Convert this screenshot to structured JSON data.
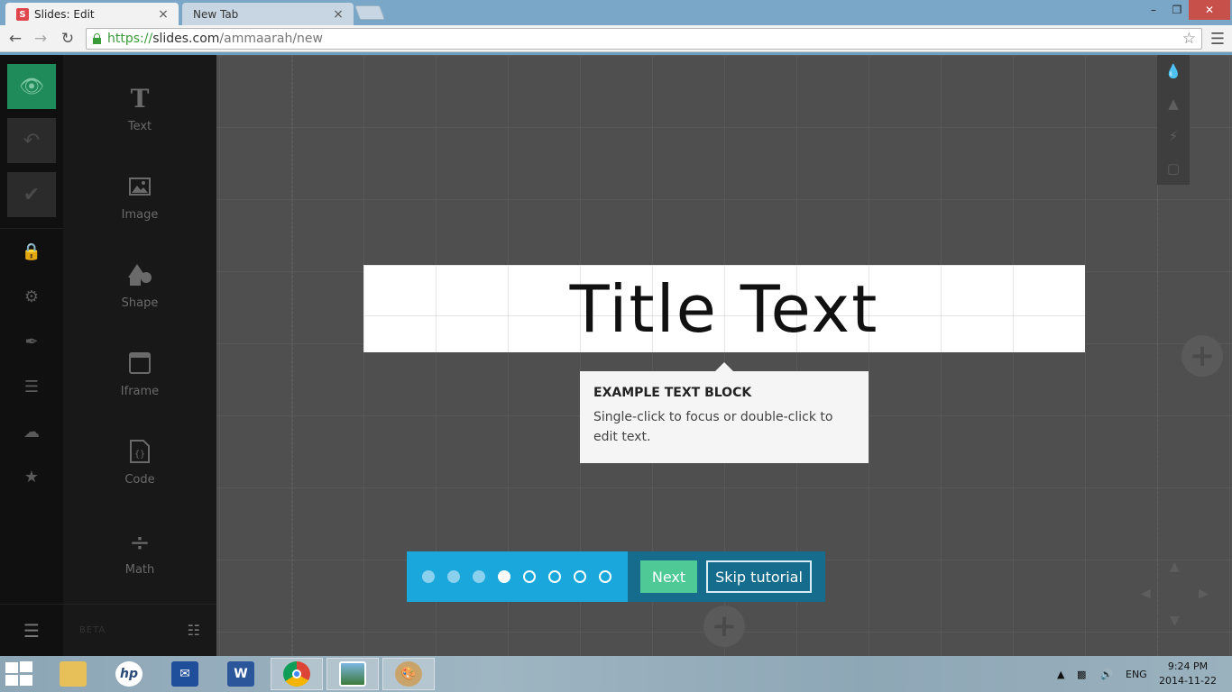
{
  "browser": {
    "tabs": [
      {
        "label": "Slides: Edit",
        "favicon": "S",
        "close": "×",
        "active": true
      },
      {
        "label": "New Tab",
        "close": "×",
        "active": false
      }
    ],
    "window_controls": {
      "minimize": "–",
      "maximize": "❐",
      "close": "✕"
    },
    "url": {
      "scheme": "https://",
      "host": "slides.com",
      "path": "/ammaarah/new"
    },
    "bookmark_icon": "star-icon",
    "menu_icon": "hamburger-menu-icon"
  },
  "editor": {
    "left_toolbar": {
      "buttons": [
        "eye-icon",
        "undo-icon",
        "checkmark-icon"
      ],
      "icons": [
        "lock-icon",
        "gear-icon",
        "brush-icon",
        "layers-icon",
        "cloud-lock-icon",
        "star-icon"
      ],
      "menu_icon": "hamburger-menu-icon"
    },
    "blocks": [
      {
        "label": "Text",
        "icon": "T"
      },
      {
        "label": "Image",
        "icon": "image-icon"
      },
      {
        "label": "Shape",
        "icon": "shape-icon"
      },
      {
        "label": "Iframe",
        "icon": "iframe-icon"
      },
      {
        "label": "Code",
        "icon": "code-icon"
      },
      {
        "label": "Math",
        "icon": "divide-icon"
      }
    ],
    "beta_label": "BETA",
    "slide": {
      "title": "Title Text"
    },
    "tooltip": {
      "title": "EXAMPLE TEXT BLOCK",
      "body": "Single-click to focus or double-click to edit text."
    },
    "right_toolbar": [
      "droplet-icon",
      "chart-icon",
      "lightning-icon",
      "book-icon"
    ],
    "tutorial": {
      "steps": [
        "visited",
        "visited",
        "visited",
        "current",
        "todo",
        "todo",
        "todo",
        "todo"
      ],
      "next_label": "Next",
      "skip_label": "Skip tutorial"
    },
    "colors": {
      "accent_green": "#1f8a5a",
      "tutorial_blue": "#1aa7dc",
      "tutorial_dark": "#166c8c",
      "next_green": "#4fc995"
    }
  },
  "taskbar": {
    "apps": [
      "file-explorer-icon",
      "hp-icon",
      "outlook-icon",
      "word-icon",
      "chrome-icon",
      "photos-icon",
      "paint-icon"
    ],
    "language": "ENG",
    "time": "9:24 PM",
    "date": "2014-11-22"
  }
}
